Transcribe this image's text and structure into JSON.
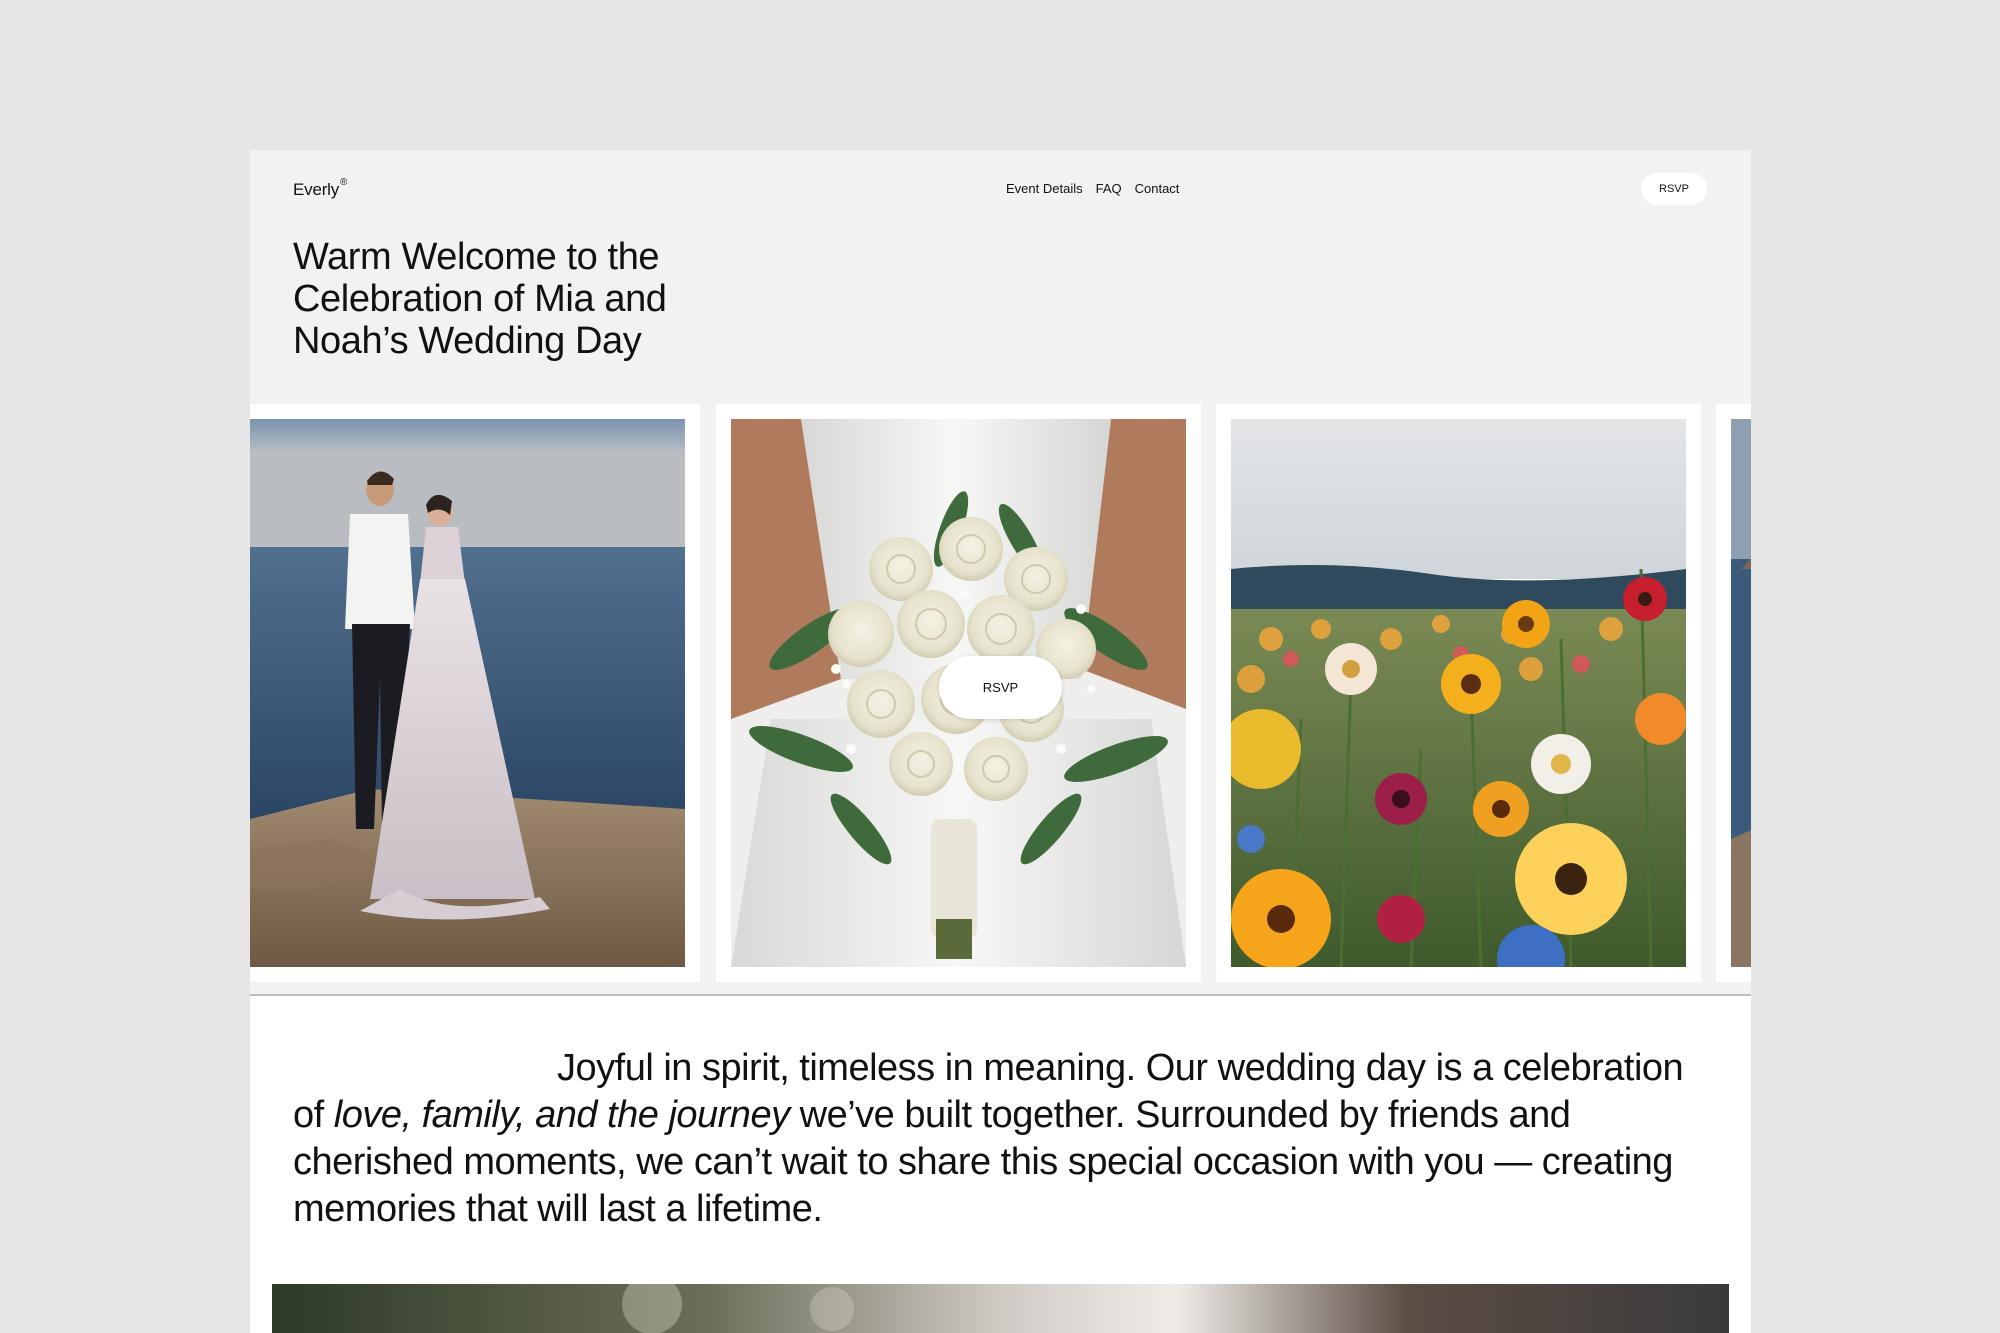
{
  "brand": {
    "name": "Everly",
    "mark": "®"
  },
  "nav": {
    "items": [
      "Event Details",
      "FAQ",
      "Contact"
    ]
  },
  "header": {
    "rsvp_label": "RSVP"
  },
  "hero": {
    "title": "Warm Welcome to the Celebration of Mia and Noah’s Wedding Day"
  },
  "gallery": {
    "cards": [
      {
        "subject": "couple-by-sea"
      },
      {
        "subject": "bridal-bouquet"
      },
      {
        "subject": "wildflower-field"
      },
      {
        "subject": "coastline"
      }
    ],
    "rsvp_label": "RSVP"
  },
  "intro": {
    "lead": "Joyful in spirit, timeless in meaning. Our wedding day is a celebration of ",
    "emphasis": "love, family, and the journey",
    "rest": " we’ve built together. Surrounded by friends and cherished moments, we can’t wait to share this special occasion with you — creating memories that will last a lifetime."
  },
  "colors": {
    "page_bg": "#e6e6e6",
    "site_bg": "#f2f2f2",
    "card_bg": "#ffffff",
    "text": "#111111"
  }
}
